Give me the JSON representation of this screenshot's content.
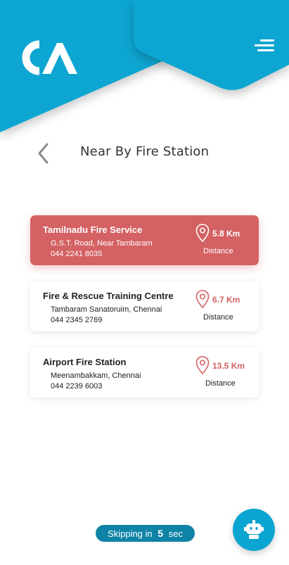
{
  "app": {
    "brand_color": "#0aa5d1",
    "active_card_color": "#d46163",
    "logo_icon": "ca-logo",
    "menu_icon": "hamburger-menu-icon",
    "back_icon": "chevron-left-icon",
    "assistant_icon": "robot-icon"
  },
  "header": {
    "title": "Near By Fire Station"
  },
  "stations": [
    {
      "name": "Tamilnadu Fire Service",
      "address": "G.S.T. Road, Near Tambaram",
      "phone": "044 2241 8035",
      "distance": "5.8 Km",
      "distance_label": "Distance",
      "selected": true
    },
    {
      "name": "Fire & Rescue Training Centre",
      "address": "Tambaram Sanatoruim, Chennai",
      "phone": "044 2345 2769",
      "distance": "6.7 Km",
      "distance_label": "Distance",
      "selected": false
    },
    {
      "name": "Airport Fire Station",
      "address": "Meenambakkam, Chennai",
      "phone": "044 2239 6003",
      "distance": "13.5 Km",
      "distance_label": "Distance",
      "selected": false
    }
  ],
  "footer": {
    "skip_prefix": "Skipping in",
    "skip_count": "5",
    "skip_unit": "sec"
  }
}
